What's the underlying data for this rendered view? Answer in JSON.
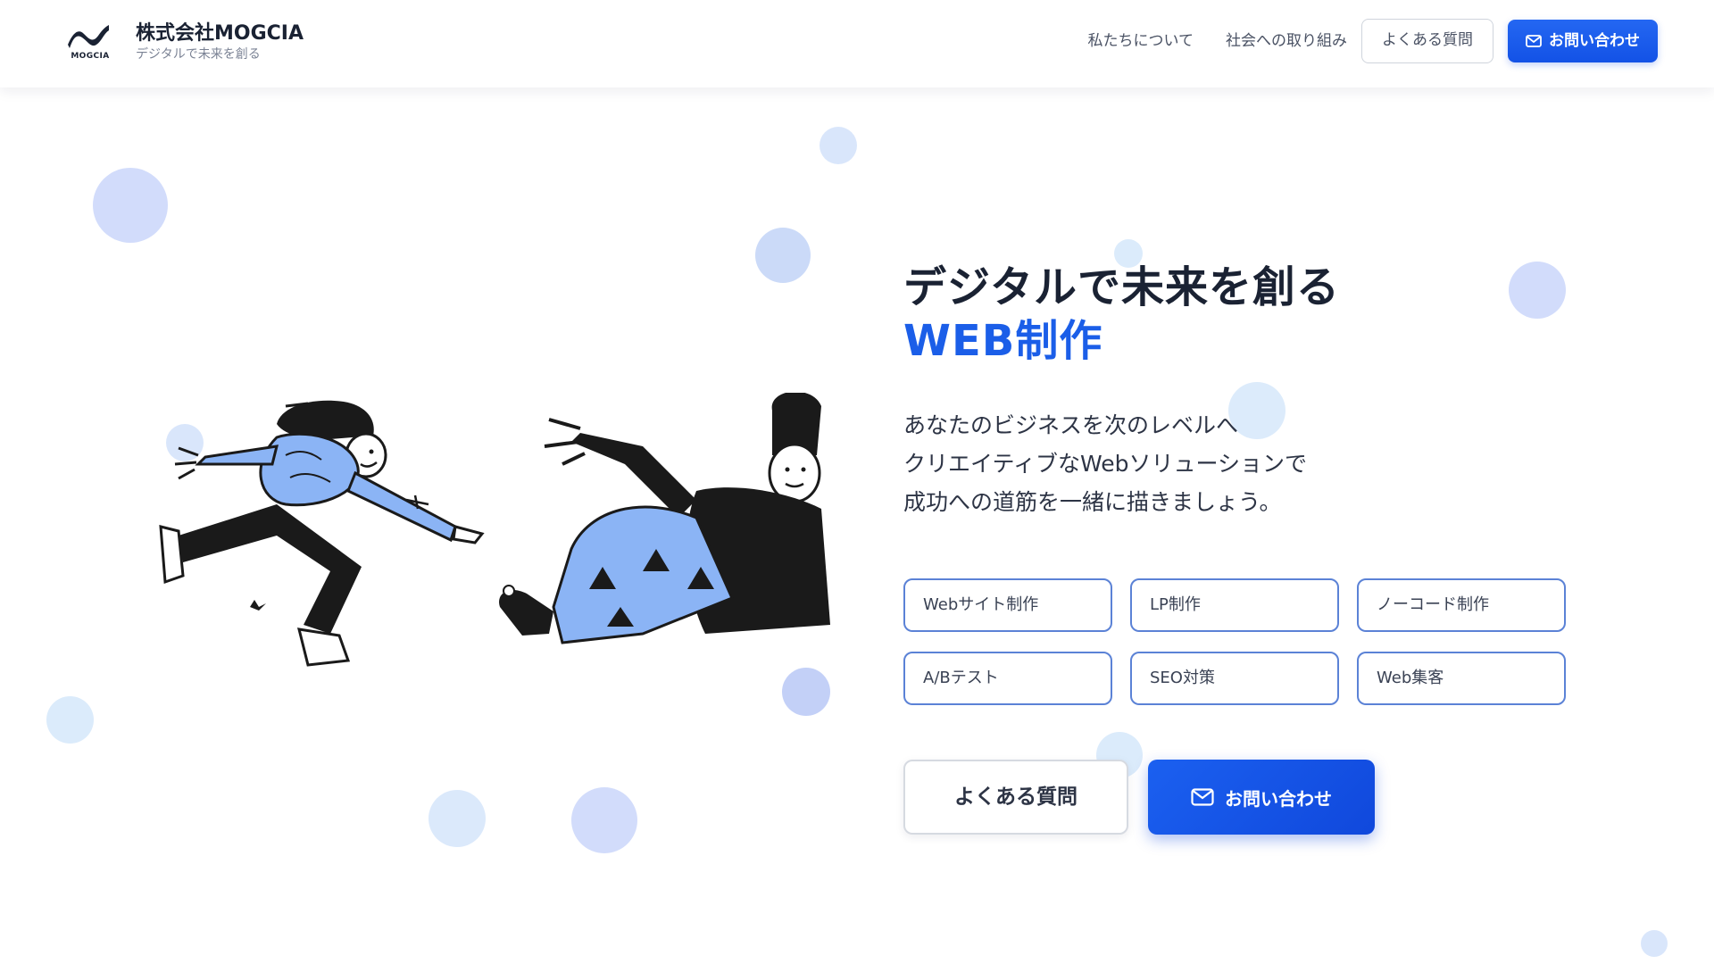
{
  "header": {
    "logo_text": "MOGCIA",
    "company_name": "株式会社MOGCIA",
    "tagline": "デジタルで未来を創る",
    "nav": {
      "about": "私たちについて",
      "social": "社会への取り組み",
      "faq": "よくある質問",
      "contact": "お問い合わせ"
    }
  },
  "hero": {
    "title_line1": "デジタルで未来を創る",
    "title_line2": "WEB制作",
    "desc_line1": "あなたのビジネスを次のレベルへ",
    "desc_line2": "クリエイティブなWebソリューションで",
    "desc_line3": "成功への道筋を一緒に描きましょう。",
    "services": [
      "Webサイト制作",
      "LP制作",
      "ノーコード制作",
      "A/Bテスト",
      "SEO対策",
      "Web集客"
    ],
    "cta_faq": "よくある質問",
    "cta_contact": "お問い合わせ"
  },
  "icons": {
    "logo": "wave-logo-icon",
    "mail": "mail-icon",
    "illustration": "two-people-reaching-illustration"
  },
  "colors": {
    "accent": "#1b5ee8",
    "button": "#1352e6",
    "text": "#1a2233",
    "service_border": "#5b82d6",
    "dot_light": "#dbe9fb",
    "dot_mid": "#c7d8fa",
    "illustration_blue": "#8bb4f5"
  }
}
